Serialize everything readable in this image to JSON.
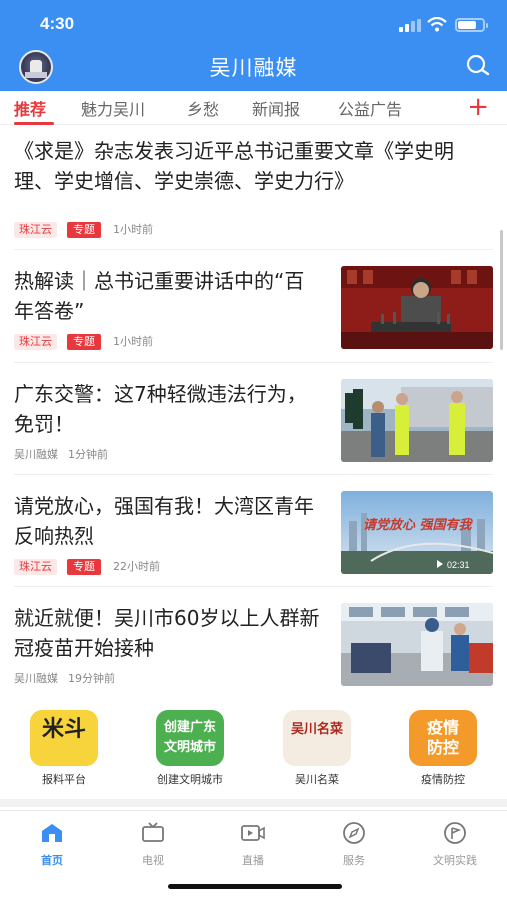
{
  "status_bar": {
    "time": "4:30"
  },
  "header": {
    "title": "吴川融媒"
  },
  "tabs": [
    {
      "label": "推荐",
      "active": true
    },
    {
      "label": "魅力吴川",
      "active": false
    },
    {
      "label": "乡愁",
      "active": false
    },
    {
      "label": "新闻报",
      "active": false
    },
    {
      "label": "公益广告",
      "active": false
    }
  ],
  "add_tab_label": "+",
  "feed": [
    {
      "headline": "《求是》杂志发表习近平总书记重要文章《学史明理、学史增信、学史崇德、学史力行》",
      "source": "珠江云",
      "badge": "专题",
      "time": "1小时前"
    },
    {
      "headline": "热解读｜总书记重要讲话中的“百年答卷”",
      "source": "珠江云",
      "badge": "专题",
      "time": "1小时前"
    },
    {
      "headline": "广东交警：这7种轻微违法行为，免罚！",
      "source": "吴川融媒",
      "time": "1分钟前"
    },
    {
      "headline": "请党放心，强国有我！大湾区青年反响热烈",
      "source": "珠江云",
      "badge": "专题",
      "time": "22小时前",
      "video_duration": "02:31",
      "thumb_caption": "请党放心 强国有我"
    },
    {
      "headline": "就近就便！吴川市60岁以上人群新冠疫苗开始接种",
      "source": "吴川融媒",
      "time": "19分钟前"
    }
  ],
  "quick_links": [
    {
      "icon_text": "米斗",
      "label": "报料平台",
      "color": "#f7d43b"
    },
    {
      "icon_text": "创建广东文明城市",
      "label": "创建文明城市",
      "color": "#4caf50"
    },
    {
      "icon_text": "吴川名菜",
      "label": "吴川名菜",
      "color": "#f4ece0"
    },
    {
      "icon_text": "疫情防控",
      "label": "疫情防控",
      "color": "#f39a2b"
    }
  ],
  "bottom_nav": [
    {
      "label": "首页",
      "icon": "home-icon",
      "active": true
    },
    {
      "label": "电视",
      "icon": "tv-icon",
      "active": false
    },
    {
      "label": "直播",
      "icon": "live-icon",
      "active": false
    },
    {
      "label": "服务",
      "icon": "compass-icon",
      "active": false
    },
    {
      "label": "文明实践",
      "icon": "flag-icon",
      "active": false
    }
  ],
  "colors": {
    "brand_blue": "#3b8ef2",
    "accent_red": "#e8383d"
  }
}
